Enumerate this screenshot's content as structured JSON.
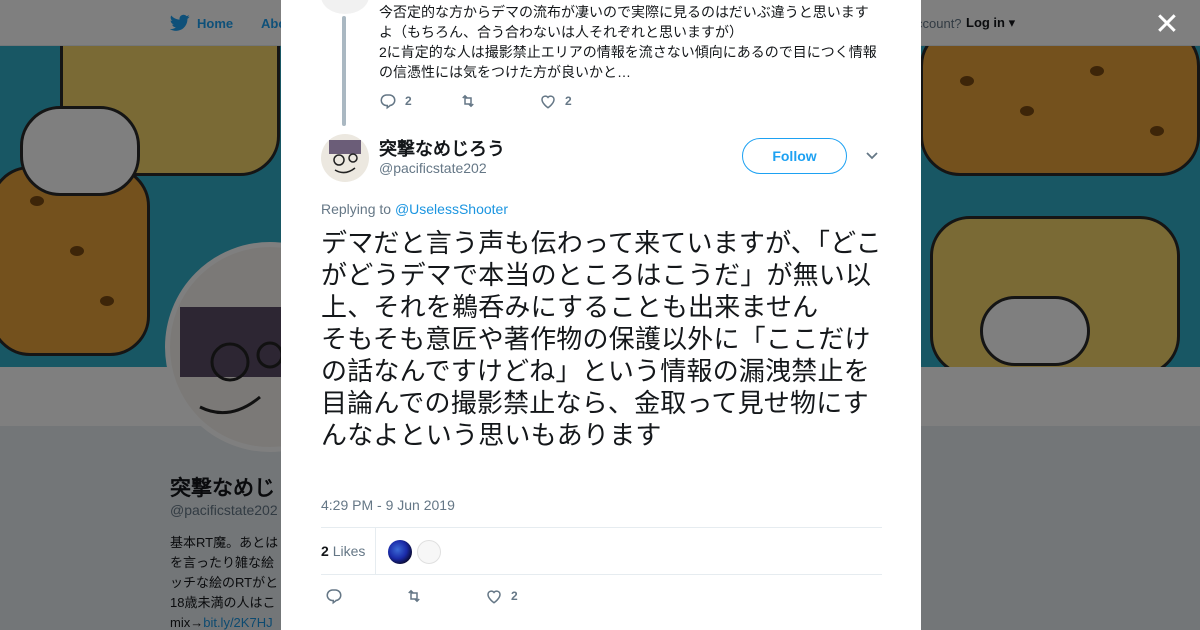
{
  "topbar": {
    "home_label": "Home",
    "about_label": "Abo",
    "account_prompt": "ccount?",
    "login_label": "Log in"
  },
  "background_profile": {
    "name": "突撃なめじ",
    "handle": "@pacificstate202",
    "bio_lines": [
      "基本RT魔。あとは",
      "を言ったり雑な絵",
      "ッチな絵のRTがと",
      "18歳未満の人はこ"
    ],
    "bio_link_prefix": "mix→",
    "bio_link": "bit.ly/2K7HJ"
  },
  "parent_tweet": {
    "text_lines": [
      "今否定的な方からデマの流布が凄いので実際に見るのはだいぶ違うと思います",
      "よ（もちろん、合う合わないは人それぞれと思いますが）",
      "2に肯定的な人は撮影禁止エリアの情報を流さない傾向にあるので目につく情報",
      "の信憑性には気をつけた方が良いかと…"
    ],
    "reply_count": "2",
    "like_count": "2"
  },
  "tweet": {
    "name": "突撃なめじろう",
    "handle": "@pacificstate202",
    "follow_label": "Follow",
    "replying_prefix": "Replying to ",
    "replying_to": "@UselessShooter",
    "text": "デマだと言う声も伝わって来ていますが、「どこがどうデマで本当のところはこうだ」が無い以上、それを鵜呑みにすることも出来ません\nそもそも意匠や著作物の保護以外に「ここだけの話なんですけどね」という情報の漏洩禁止を目論んでの撮影禁止なら、金取って見せ物にすんなよという思いもあります",
    "timestamp": "4:29 PM - 9 Jun 2019",
    "likes_count": "2",
    "likes_label": "Likes",
    "action_like_count": "2"
  },
  "icons": {
    "close": "close-icon",
    "reply": "reply-icon",
    "retweet": "retweet-icon",
    "like": "heart-icon",
    "caret": "chevron-down-icon",
    "brand": "twitter-bird-icon"
  },
  "colors": {
    "accent": "#1da1f2",
    "banner": "#30aec9",
    "muted": "#657786"
  }
}
